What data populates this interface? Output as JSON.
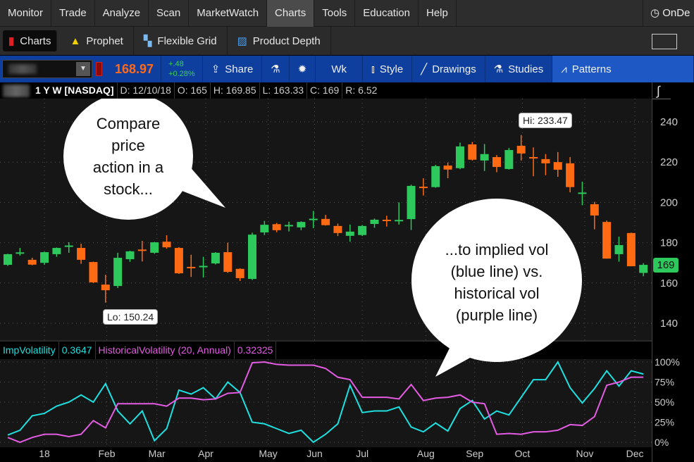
{
  "menu": {
    "items": [
      "Monitor",
      "Trade",
      "Analyze",
      "Scan",
      "MarketWatch",
      "Charts",
      "Tools",
      "Education",
      "Help"
    ],
    "active": "Charts",
    "right_label": "OnDe"
  },
  "subnav": {
    "items": [
      {
        "label": "Charts",
        "icon": "bar-chart-icon"
      },
      {
        "label": "Prophet",
        "icon": "prophet-icon"
      },
      {
        "label": "Flexible Grid",
        "icon": "grid-icon"
      },
      {
        "label": "Product Depth",
        "icon": "depth-icon"
      }
    ]
  },
  "toolbar": {
    "last": "168.97",
    "change": "+.48",
    "change_pct": "+0.28%",
    "share": "Share",
    "period": "Wk",
    "style": "Style",
    "drawings": "Drawings",
    "studies": "Studies",
    "patterns": "Patterns"
  },
  "header": {
    "period": "1 Y W [NASDAQ]",
    "date": "D: 12/10/18",
    "open": "O: 165",
    "high": "H: 169.85",
    "low": "L: 163.33",
    "close": "C: 169",
    "range": "R: 6.52"
  },
  "study": {
    "imp_label": "ImpVolatility",
    "imp_value": "0.3647",
    "hist_label": "HistoricalVolatility (20, Annual)",
    "hist_value": "0.32325"
  },
  "annotations": {
    "hi": "Hi: 233.47",
    "lo": "Lo: 150.24",
    "last_price": "169",
    "bubble1": [
      "Compare",
      "price",
      "action in a",
      "stock..."
    ],
    "bubble2": [
      "...to implied vol",
      "(blue line) vs.",
      "historical vol",
      "(purple line)"
    ]
  },
  "colors": {
    "up": "#2ec95c",
    "down": "#ff6a13",
    "imp": "#1ee0e0",
    "hist": "#e45ce4",
    "toolbar": "#0e3e9e"
  },
  "chart_data": [
    {
      "type": "candlestick",
      "title": "",
      "price_ticks": [
        140,
        160,
        180,
        200,
        220,
        240
      ],
      "ylim": [
        133,
        255
      ],
      "grid": true,
      "candles": [
        [
          169,
          174.5,
          168.5,
          174.3
        ],
        [
          175,
          177.4,
          173.6,
          175.2
        ],
        [
          171.5,
          172.5,
          168.8,
          169.1
        ],
        [
          170,
          175.5,
          169,
          175.3
        ],
        [
          174.3,
          177.6,
          173,
          177.4
        ],
        [
          178.5,
          180.2,
          175,
          178.6
        ],
        [
          177.4,
          179.5,
          169.5,
          171.5
        ],
        [
          170.4,
          170.6,
          160,
          160.3
        ],
        [
          159.2,
          164.1,
          150.24,
          156.4
        ],
        [
          158.5,
          175,
          157.5,
          172.5
        ],
        [
          171.8,
          176,
          170.5,
          175.7
        ],
        [
          176.6,
          180.9,
          170.7,
          176.4
        ],
        [
          175,
          180.4,
          174.5,
          180.2
        ],
        [
          180.5,
          183.7,
          177,
          177.7
        ],
        [
          177.4,
          177.8,
          164.5,
          164.8
        ],
        [
          168,
          174,
          163,
          167.8
        ],
        [
          168.3,
          173,
          162.7,
          168.5
        ],
        [
          169.7,
          175.3,
          169.2,
          175
        ],
        [
          175.3,
          180,
          165,
          165.5
        ],
        [
          167,
          167.3,
          161,
          162.4
        ],
        [
          162,
          185,
          161.5,
          184
        ],
        [
          185.1,
          190.8,
          183.8,
          188.9
        ],
        [
          189.2,
          189.8,
          185.2,
          186.2
        ],
        [
          188.6,
          190.4,
          185.6,
          188.8
        ],
        [
          187.6,
          190.6,
          186.2,
          190.3
        ],
        [
          191.7,
          195.8,
          187.2,
          191.9
        ],
        [
          191.8,
          193.8,
          188.5,
          188.7
        ],
        [
          188.3,
          189.5,
          183.3,
          184.8
        ],
        [
          183.4,
          189,
          180.5,
          185.5
        ],
        [
          183.8,
          188.8,
          183.3,
          188.3
        ],
        [
          189.3,
          192,
          187.4,
          191.4
        ],
        [
          191.4,
          193.4,
          188,
          191.3
        ],
        [
          191.1,
          200,
          189,
          191.3
        ],
        [
          191.7,
          208.8,
          186.3,
          208.2
        ],
        [
          207.8,
          212,
          203.4,
          207.6
        ],
        [
          207.6,
          218.6,
          207.3,
          218
        ],
        [
          218.3,
          219.8,
          212,
          216.3
        ],
        [
          217,
          229.7,
          216.5,
          227.8
        ],
        [
          228.8,
          230,
          220.8,
          221.2
        ],
        [
          220.8,
          229,
          215.6,
          224
        ],
        [
          222.5,
          223.5,
          215,
          217.6
        ],
        [
          216.6,
          227,
          216.3,
          226
        ],
        [
          228.1,
          233.47,
          220.8,
          224.3
        ],
        [
          222.5,
          227.3,
          213,
          222.3
        ],
        [
          221.5,
          224,
          213.5,
          219.4
        ],
        [
          220,
          225,
          212.7,
          216.2
        ],
        [
          219.4,
          222.5,
          205,
          207.6
        ],
        [
          204.7,
          210.3,
          198.6,
          204.9
        ],
        [
          199.1,
          200.3,
          186.6,
          193.5
        ],
        [
          190.3,
          191,
          172.1,
          172.1
        ],
        [
          174.3,
          183,
          170.6,
          178.8
        ],
        [
          184.8,
          185,
          168.3,
          168.3
        ],
        [
          165,
          169.85,
          163.33,
          169
        ]
      ]
    },
    {
      "type": "line",
      "title": "",
      "y_ticks": [
        "0%",
        "25%",
        "50%",
        "75%",
        "100%"
      ],
      "ylim": [
        0,
        100
      ],
      "x_labels": [
        {
          "label": "18",
          "week_index": 3
        },
        {
          "label": "Feb",
          "week_index": 8.1
        },
        {
          "label": "Mar",
          "week_index": 12.2
        },
        {
          "label": "Apr",
          "week_index": 16.2
        },
        {
          "label": "May",
          "week_index": 21.3
        },
        {
          "label": "Jun",
          "week_index": 25.1
        },
        {
          "label": "Jul",
          "week_index": 29
        },
        {
          "label": "Aug",
          "week_index": 34.2
        },
        {
          "label": "Sep",
          "week_index": 38.2
        },
        {
          "label": "Oct",
          "week_index": 42.1
        },
        {
          "label": "Nov",
          "week_index": 47.2
        },
        {
          "label": "Dec",
          "week_index": 51.3
        }
      ],
      "series": [
        {
          "name": "ImpVolatility",
          "values": [
            9,
            15,
            33,
            36,
            45,
            50,
            59,
            50,
            73,
            39,
            23,
            39,
            2,
            17,
            65,
            60,
            68,
            54,
            75,
            62,
            25,
            23,
            17,
            11,
            15,
            0,
            10,
            23,
            71,
            37,
            39,
            39,
            44,
            19,
            13,
            24,
            14,
            42,
            52,
            29,
            39,
            34,
            56,
            78,
            78,
            100,
            68,
            49,
            67,
            89,
            70,
            89,
            85
          ]
        },
        {
          "name": "HistoricalVolatility (20, Annual)",
          "values": [
            6,
            0,
            6,
            10,
            10,
            7,
            10,
            27,
            18,
            48,
            48,
            48,
            48,
            45,
            55,
            55,
            53,
            54,
            61,
            62,
            99,
            100,
            97,
            96,
            96,
            96,
            92,
            81,
            78,
            56,
            56,
            56,
            54,
            72,
            52,
            55,
            56,
            59,
            50,
            48,
            10,
            11,
            10,
            13,
            13,
            15,
            22,
            21,
            32,
            71,
            75,
            81,
            81
          ]
        }
      ]
    }
  ]
}
